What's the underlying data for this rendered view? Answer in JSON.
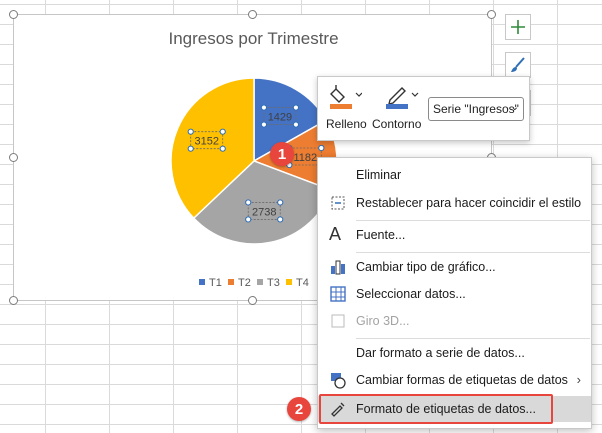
{
  "chart": {
    "title": "Ingresos por Trimestre"
  },
  "chart_data": {
    "type": "pie",
    "title": "Ingresos por Trimestre",
    "categories": [
      "T1",
      "T2",
      "T3",
      "T4"
    ],
    "values": [
      1429,
      1182,
      2738,
      3152
    ],
    "colors": [
      "#4472c4",
      "#ed7d31",
      "#a5a5a5",
      "#ffc000"
    ],
    "legend": "bottom"
  },
  "format_toolbar": {
    "fill_label": "Relleno",
    "outline_label": "Contorno",
    "series_value": "Serie \"Ingresos\"",
    "fill_color": "#ed7d31",
    "outline_color": "#4472c4"
  },
  "context_menu": {
    "items": [
      {
        "label": "Eliminar",
        "icon": "none",
        "disabled": false
      },
      {
        "label": "Restablecer para hacer coincidir el estilo",
        "icon": "reset-style-icon",
        "disabled": false
      },
      {
        "label": "Fuente...",
        "icon": "font-icon",
        "disabled": false
      },
      {
        "label": "Cambiar tipo de gráfico...",
        "icon": "chart-type-icon",
        "disabled": false
      },
      {
        "label": "Seleccionar datos...",
        "icon": "select-data-icon",
        "disabled": false
      },
      {
        "label": "Giro 3D...",
        "icon": "rotation-3d-icon",
        "disabled": true
      },
      {
        "label": "Dar formato a serie de datos...",
        "icon": "none",
        "disabled": false
      },
      {
        "label": "Cambiar formas de etiquetas de datos",
        "icon": "label-shapes-icon",
        "disabled": false
      },
      {
        "label": "Formato de etiquetas de datos...",
        "icon": "format-labels-icon",
        "disabled": false
      }
    ]
  },
  "badges": {
    "step1": "1",
    "step2": "2",
    "color": "#e8453c"
  }
}
